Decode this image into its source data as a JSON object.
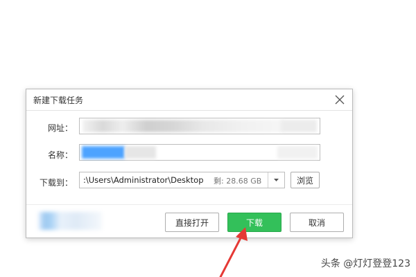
{
  "dialog": {
    "title": "新建下载任务",
    "url_label": "网址：",
    "name_label": "名称：",
    "save_to_label": "下载到：",
    "save_path": ":\\Users\\Administrator\\Desktop",
    "free_space": "剩: 28.68 GB",
    "browse_label": "浏览",
    "open_direct_label": "直接打开",
    "download_label": "下载",
    "cancel_label": "取消"
  },
  "watermark": {
    "text": "头条 @灯灯登登123"
  },
  "colors": {
    "primary_button": "#33c05a",
    "arrow": "#e53935",
    "name_selection": "#4da3ff"
  }
}
